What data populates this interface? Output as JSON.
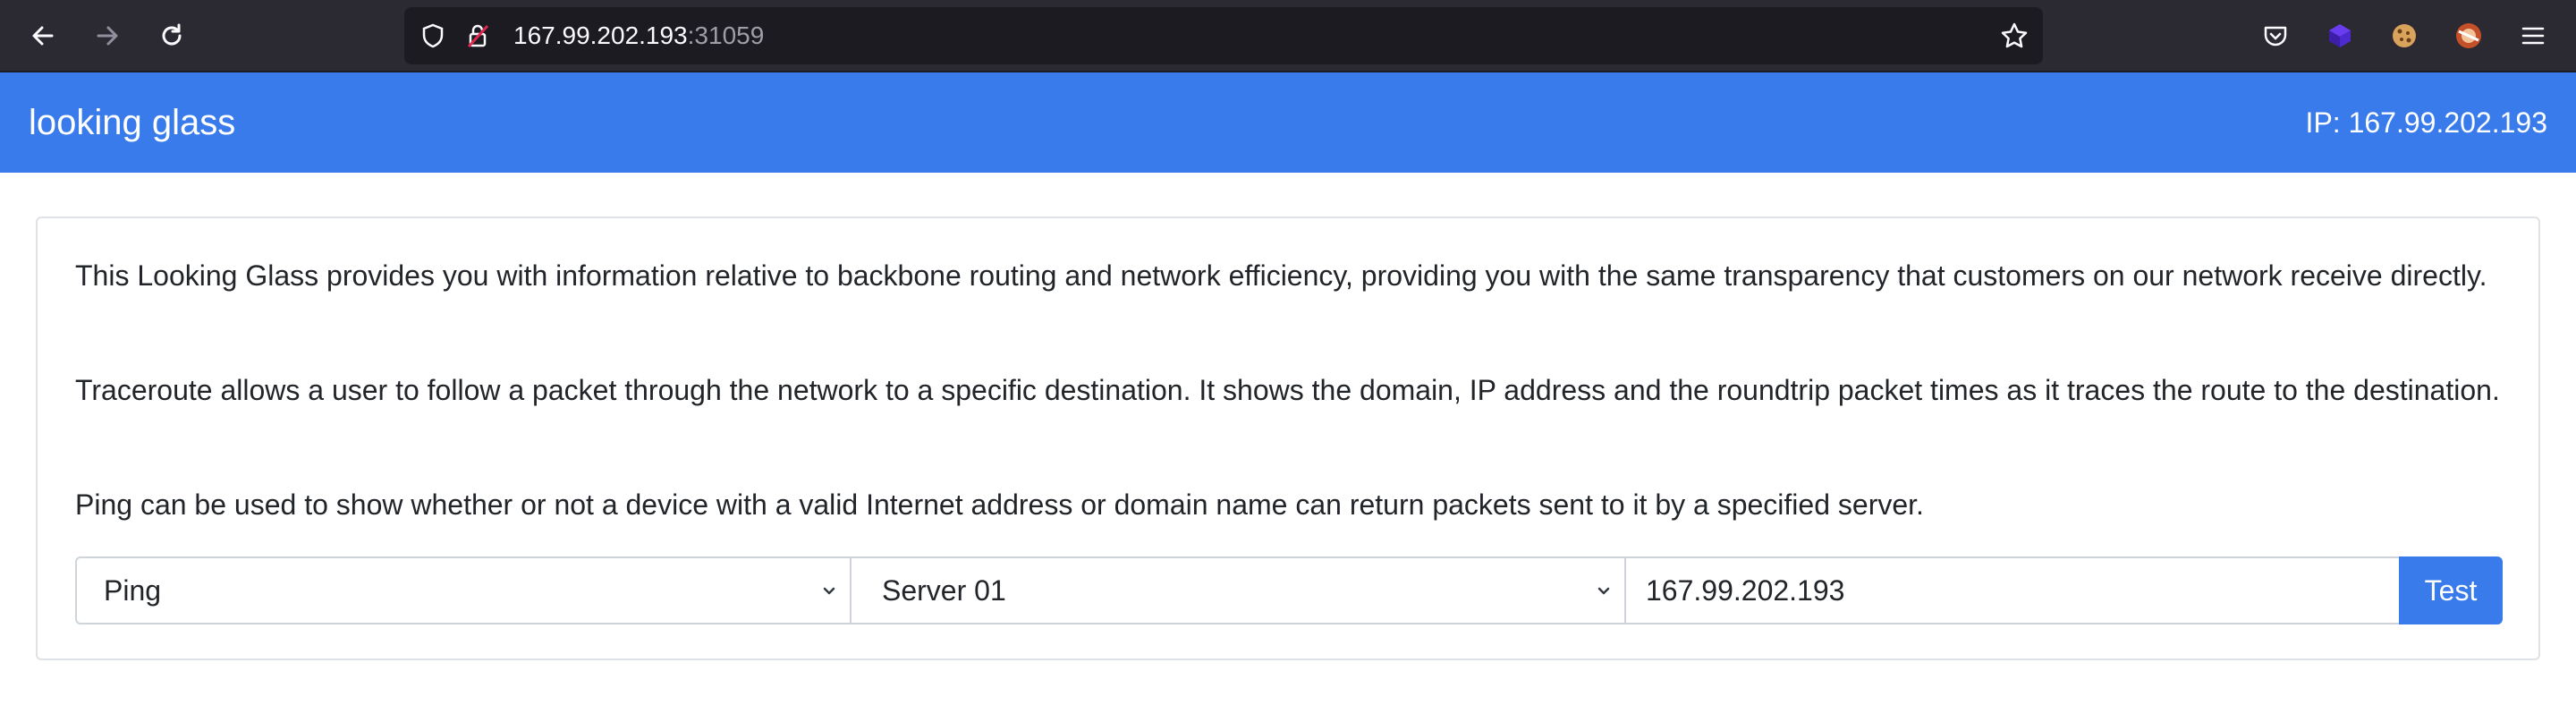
{
  "browser": {
    "url_host": "167.99.202.193",
    "url_port": ":31059",
    "icons": [
      "back-icon",
      "forward-icon",
      "reload-icon",
      "shield-icon",
      "insecure-lock-icon",
      "bookmark-star-icon",
      "pocket-icon",
      "extension-cube-icon",
      "cookie-icon",
      "extension-avatar-icon",
      "menu-icon"
    ]
  },
  "navbar": {
    "brand": "looking glass",
    "ip_label": "IP: 167.99.202.193",
    "color": "#3a7bec"
  },
  "card": {
    "intro": "This Looking Glass provides you with information relative to backbone routing and network efficiency, providing you with the same transparency that customers on our network receive directly.",
    "traceroute": "Traceroute allows a user to follow a packet through the network to a specific destination. It shows the domain, IP address and the roundtrip packet times as it traces the route to the destination.",
    "ping": "Ping can be used to show whether or not a device with a valid Internet address or domain name can return packets sent to it by a specified server."
  },
  "form": {
    "method_selected": "Ping",
    "server_selected": "Server 01",
    "target_value": "167.99.202.193",
    "test_label": "Test"
  }
}
